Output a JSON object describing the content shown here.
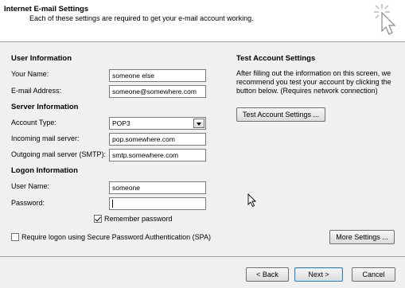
{
  "header": {
    "title": "Internet E-mail Settings",
    "subtitle": "Each of these settings are required to get your e-mail account working."
  },
  "user_info": {
    "heading": "User Information",
    "your_name_label": "Your Name:",
    "your_name_value": "someone else",
    "email_label": "E-mail Address:",
    "email_value": "someone@somewhere.com"
  },
  "server_info": {
    "heading": "Server Information",
    "account_type_label": "Account Type:",
    "account_type_value": "POP3",
    "incoming_label": "Incoming mail server:",
    "incoming_value": "pop.somewhere.com",
    "outgoing_label": "Outgoing mail server (SMTP):",
    "outgoing_value": "smtp.somewhere.com"
  },
  "logon_info": {
    "heading": "Logon Information",
    "user_name_label": "User Name:",
    "user_name_value": "someone",
    "password_label": "Password:",
    "password_value": "",
    "remember_password_label": "Remember password",
    "remember_password_checked": true,
    "spa_label": "Require logon using Secure Password Authentication (SPA)",
    "spa_checked": false
  },
  "test_settings": {
    "heading": "Test Account Settings",
    "description_line1": "After filling out the information on this screen, we",
    "description_line2": "recommend you test your account by clicking the",
    "description_line3": "button below. (Requires network connection)",
    "test_button": "Test Account Settings ..."
  },
  "more_settings_button": "More Settings ...",
  "footer": {
    "back_button": "< Back",
    "next_button": "Next >",
    "cancel_button": "Cancel"
  },
  "icons": {
    "wizard": "sparkle-cursor-icon",
    "pointer": "mouse-pointer-icon"
  },
  "colors": {
    "content_background": "#f0f0f0",
    "header_background": "#ffffff",
    "default_button_border": "#3c7fb1"
  }
}
